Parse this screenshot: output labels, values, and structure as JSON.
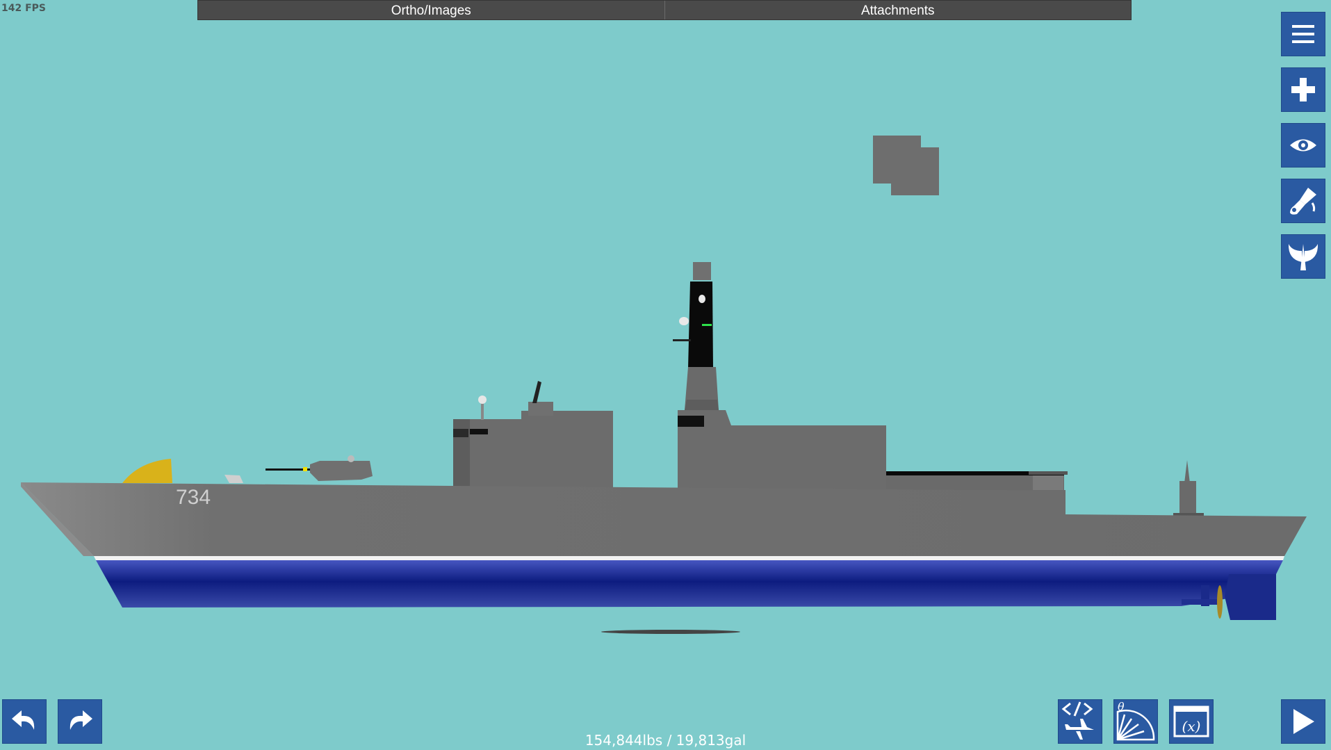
{
  "fps": "142 FPS",
  "tabs": {
    "ortho": "Ortho/Images",
    "attachments": "Attachments"
  },
  "hull_number": "734",
  "status": "154,844lbs / 19,813gal",
  "right_toolbar": [
    "menu-icon",
    "add-part-icon",
    "view-eye-icon",
    "paint-brush-icon",
    "wings-icon"
  ],
  "bottom_left": [
    "undo-icon",
    "redo-icon"
  ],
  "bottom_right": [
    "code-aircraft-icon",
    "angle-gauge-icon",
    "variables-icon",
    "play-icon"
  ],
  "colors": {
    "background": "#7ecbcb",
    "button": "#2a5aa2",
    "tab_bar": "#4a4a4a",
    "hull_grey": "#6e6e6e",
    "hull_blue": "#2a3a9a"
  }
}
